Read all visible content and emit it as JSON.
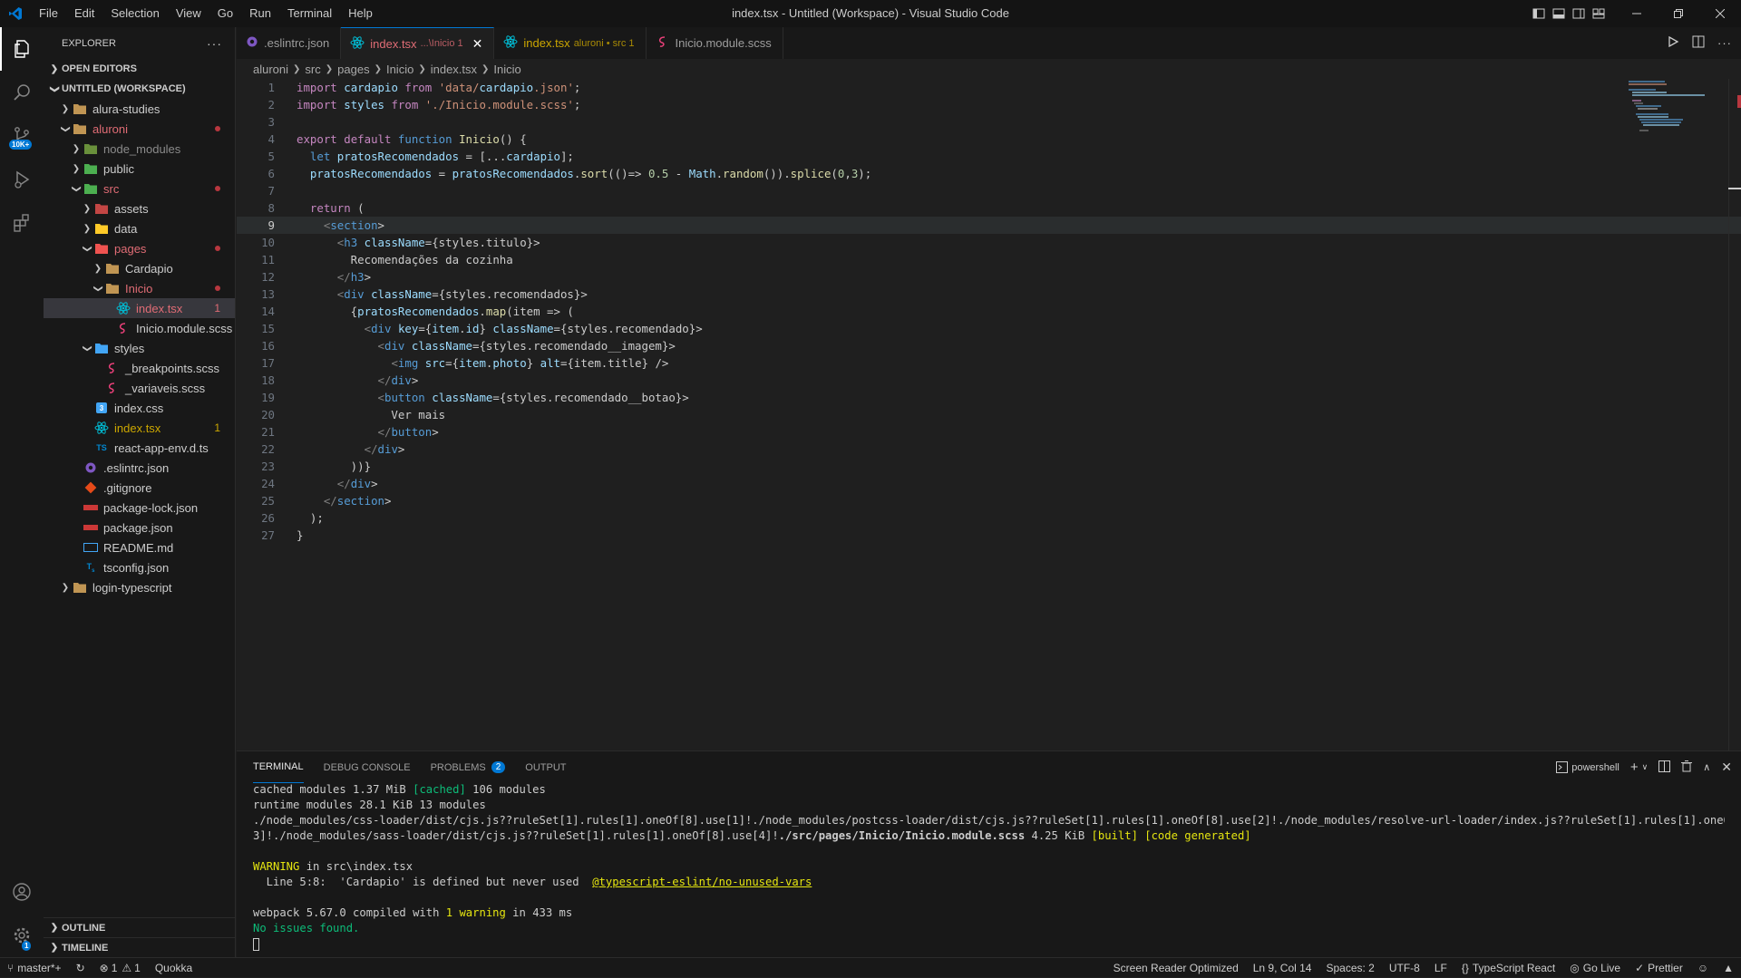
{
  "window": {
    "title": "index.tsx - Untitled (Workspace) - Visual Studio Code"
  },
  "menu": [
    "File",
    "Edit",
    "Selection",
    "View",
    "Go",
    "Run",
    "Terminal",
    "Help"
  ],
  "activity": {
    "badge": "10K+",
    "settings_badge": "1"
  },
  "sidebar": {
    "title": "EXPLORER",
    "open_editors": "OPEN EDITORS",
    "workspace": "UNTITLED (WORKSPACE)",
    "tree": [
      {
        "label": "alura-studies",
        "depth": 1,
        "twistie": ">",
        "icon": "folder-icon",
        "color": "#cccccc"
      },
      {
        "label": "aluroni",
        "depth": 1,
        "twistie": "v",
        "icon": "folder-icon",
        "color": "#e06c75",
        "dot": true
      },
      {
        "label": "node_modules",
        "depth": 2,
        "twistie": ">",
        "icon": "node-folder-icon",
        "color": "#8b8b8b"
      },
      {
        "label": "public",
        "depth": 2,
        "twistie": ">",
        "icon": "public-folder-icon",
        "color": "#cccccc"
      },
      {
        "label": "src",
        "depth": 2,
        "twistie": "v",
        "icon": "src-folder-icon",
        "color": "#e06c75",
        "dot": true
      },
      {
        "label": "assets",
        "depth": 3,
        "twistie": ">",
        "icon": "assets-folder-icon",
        "color": "#cccccc"
      },
      {
        "label": "data",
        "depth": 3,
        "twistie": ">",
        "icon": "data-folder-icon",
        "color": "#cccccc"
      },
      {
        "label": "pages",
        "depth": 3,
        "twistie": "v",
        "icon": "pages-folder-icon",
        "color": "#e06c75",
        "dot": true
      },
      {
        "label": "Cardapio",
        "depth": 4,
        "twistie": ">",
        "icon": "folder-icon",
        "color": "#cccccc"
      },
      {
        "label": "Inicio",
        "depth": 4,
        "twistie": "v",
        "icon": "folder-icon",
        "color": "#e06c75",
        "dot": true
      },
      {
        "label": "index.tsx",
        "depth": 5,
        "twistie": "",
        "icon": "react-icon",
        "color": "#e06c75",
        "num": "1",
        "selected": true
      },
      {
        "label": "Inicio.module.scss",
        "depth": 5,
        "twistie": "",
        "icon": "sass-icon",
        "color": "#cccccc"
      },
      {
        "label": "styles",
        "depth": 3,
        "twistie": "v",
        "icon": "styles-folder-icon",
        "color": "#cccccc"
      },
      {
        "label": "_breakpoints.scss",
        "depth": 4,
        "twistie": "",
        "icon": "sass-icon",
        "color": "#cccccc"
      },
      {
        "label": "_variaveis.scss",
        "depth": 4,
        "twistie": "",
        "icon": "sass-icon",
        "color": "#cccccc"
      },
      {
        "label": "index.css",
        "depth": 3,
        "twistie": "",
        "icon": "css-icon",
        "color": "#cccccc"
      },
      {
        "label": "index.tsx",
        "depth": 3,
        "twistie": "",
        "icon": "react-icon",
        "color": "#cca700",
        "num": "1"
      },
      {
        "label": "react-app-env.d.ts",
        "depth": 3,
        "twistie": "",
        "icon": "typescript-icon",
        "color": "#cccccc"
      },
      {
        "label": ".eslintrc.json",
        "depth": 2,
        "twistie": "",
        "icon": "eslint-icon",
        "color": "#cccccc"
      },
      {
        "label": ".gitignore",
        "depth": 2,
        "twistie": "",
        "icon": "git-icon",
        "color": "#cccccc"
      },
      {
        "label": "package-lock.json",
        "depth": 2,
        "twistie": "",
        "icon": "npm-icon",
        "color": "#cccccc"
      },
      {
        "label": "package.json",
        "depth": 2,
        "twistie": "",
        "icon": "npm-icon",
        "color": "#cccccc"
      },
      {
        "label": "README.md",
        "depth": 2,
        "twistie": "",
        "icon": "markdown-icon",
        "color": "#cccccc"
      },
      {
        "label": "tsconfig.json",
        "depth": 2,
        "twistie": "",
        "icon": "tsconfig-icon",
        "color": "#cccccc"
      },
      {
        "label": "login-typescript",
        "depth": 1,
        "twistie": ">",
        "icon": "folder-icon",
        "color": "#cccccc"
      }
    ],
    "outline": "OUTLINE",
    "timeline": "TIMELINE"
  },
  "tabs": [
    {
      "label": ".eslintrc.json",
      "desc": "",
      "icon": "eslint-icon",
      "active": false,
      "color": "#9d9d9d"
    },
    {
      "label": "index.tsx",
      "desc": "...\\Inicio 1",
      "icon": "react-icon",
      "active": true,
      "color": "#e06c75"
    },
    {
      "label": "index.tsx",
      "desc": "aluroni • src 1",
      "icon": "react-icon",
      "active": false,
      "color": "#cca700"
    },
    {
      "label": "Inicio.module.scss",
      "desc": "",
      "icon": "sass-icon",
      "active": false,
      "color": "#9d9d9d"
    }
  ],
  "breadcrumbs": [
    "aluroni",
    "src",
    "pages",
    "Inicio",
    "index.tsx",
    "Inicio"
  ],
  "code_lines": [
    "import cardapio from 'data/cardapio.json';",
    "import styles from './Inicio.module.scss';",
    "",
    "export default function Inicio() {",
    "  let pratosRecomendados = [...cardapio];",
    "  pratosRecomendados = pratosRecomendados.sort(()=> 0.5 - Math.random()).splice(0,3);",
    "",
    "  return (",
    "    <section>",
    "      <h3 className={styles.titulo}>",
    "        Recomendações da cozinha",
    "      </h3>",
    "      <div className={styles.recomendados}>",
    "        {pratosRecomendados.map(item => (",
    "          <div key={item.id} className={styles.recomendado}>",
    "            <div className={styles.recomendado__imagem}>",
    "              <img src={item.photo} alt={item.title} />",
    "            </div>",
    "            <button className={styles.recomendado__botao}>",
    "              Ver mais",
    "            </button>",
    "          </div>",
    "        ))}",
    "      </div>",
    "    </section>",
    "  );",
    "}"
  ],
  "current_line": 9,
  "panel": {
    "tabs": [
      {
        "label": "TERMINAL",
        "active": true
      },
      {
        "label": "DEBUG CONSOLE",
        "active": false
      },
      {
        "label": "PROBLEMS",
        "active": false,
        "badge": "2"
      },
      {
        "label": "OUTPUT",
        "active": false
      }
    ],
    "shell": "powershell",
    "terminal": [
      {
        "parts": [
          {
            "t": "cached modules 1.37 MiB "
          },
          {
            "t": "[cached]",
            "c": "gr"
          },
          {
            "t": " 106 modules"
          }
        ]
      },
      {
        "parts": [
          {
            "t": "runtime modules 28.1 KiB 13 modules"
          }
        ]
      },
      {
        "parts": [
          {
            "t": "./node_modules/css-loader/dist/cjs.js??ruleSet[1].rules[1].oneOf[8].use[1]!./node_modules/postcss-loader/dist/cjs.js??ruleSet[1].rules[1].oneOf[8].use[2]!./node_modules/resolve-url-loader/index.js??ruleSet[1].rules[1].oneOf[8].use["
          }
        ]
      },
      {
        "parts": [
          {
            "t": "3]!./node_modules/sass-loader/dist/cjs.js??ruleSet[1].rules[1].oneOf[8].use[4]!"
          },
          {
            "t": "./src/pages/Inicio/Inicio.module.scss",
            "c": "bold"
          },
          {
            "t": " 4.25 KiB "
          },
          {
            "t": "[built] [code generated]",
            "c": "y"
          }
        ]
      },
      {
        "parts": [
          {
            "t": ""
          }
        ]
      },
      {
        "parts": [
          {
            "t": "WARNING",
            "c": "y"
          },
          {
            "t": " in src\\index.tsx"
          }
        ]
      },
      {
        "parts": [
          {
            "t": "  Line 5:8:  'Cardapio' is defined but never used  "
          },
          {
            "t": "@typescript-eslint/no-unused-vars",
            "c": "yu"
          }
        ]
      },
      {
        "parts": [
          {
            "t": ""
          }
        ]
      },
      {
        "parts": [
          {
            "t": "webpack 5.67.0 compiled with "
          },
          {
            "t": "1 warning",
            "c": "y"
          },
          {
            "t": " in 433 ms"
          }
        ]
      },
      {
        "parts": [
          {
            "t": "No issues found.",
            "c": "gr"
          }
        ]
      }
    ]
  },
  "status": {
    "branch": "master*+",
    "errors": "1",
    "warnings": "1",
    "quokka": "Quokka",
    "screen_reader": "Screen Reader Optimized",
    "position": "Ln 9, Col 14",
    "spaces": "Spaces: 2",
    "encoding": "UTF-8",
    "eol": "LF",
    "language": "TypeScript React",
    "golive": "Go Live",
    "prettier": "Prettier"
  }
}
